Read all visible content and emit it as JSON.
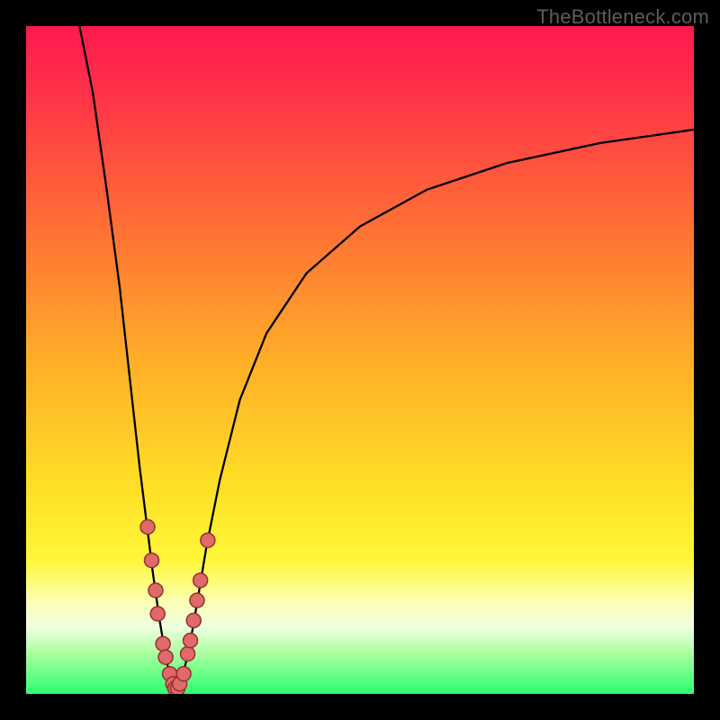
{
  "watermark": "TheBottleneck.com",
  "gradient": {
    "stops": [
      {
        "pct": 0,
        "color": "#ff1850"
      },
      {
        "pct": 12,
        "color": "#ff3846"
      },
      {
        "pct": 30,
        "color": "#ff6f35"
      },
      {
        "pct": 50,
        "color": "#ffae28"
      },
      {
        "pct": 70,
        "color": "#ffe226"
      },
      {
        "pct": 80,
        "color": "#fff73a"
      },
      {
        "pct": 86,
        "color": "#fdffb0"
      },
      {
        "pct": 90,
        "color": "#f0ffe0"
      },
      {
        "pct": 94,
        "color": "#a8ff9e"
      },
      {
        "pct": 100,
        "color": "#2cff70"
      }
    ]
  },
  "chart_data": {
    "type": "line",
    "title": "",
    "xlabel": "",
    "ylabel": "",
    "xlim": [
      0,
      100
    ],
    "ylim": [
      0,
      100
    ],
    "series": [
      {
        "name": "left-branch",
        "x": [
          8,
          10,
          12,
          14,
          15,
          16,
          17,
          18,
          19,
          20,
          20.5,
          21,
          21.5,
          22,
          22.5
        ],
        "y": [
          100,
          90,
          76,
          61,
          52,
          43,
          34,
          26,
          18,
          11,
          8,
          5,
          3,
          1.5,
          0.5
        ]
      },
      {
        "name": "right-branch",
        "x": [
          22.5,
          23,
          23.5,
          24,
          24.5,
          25,
          26,
          27,
          29,
          32,
          36,
          42,
          50,
          60,
          72,
          86,
          100
        ],
        "y": [
          0.5,
          1.5,
          3,
          5,
          7.5,
          10,
          16,
          22,
          32,
          44,
          54,
          63,
          70,
          75.5,
          79.5,
          82.5,
          84.5
        ]
      }
    ],
    "scatter": {
      "name": "highlight-dots",
      "points": [
        {
          "x": 18.2,
          "y": 25
        },
        {
          "x": 18.8,
          "y": 20
        },
        {
          "x": 19.4,
          "y": 15.5
        },
        {
          "x": 19.7,
          "y": 12
        },
        {
          "x": 20.5,
          "y": 7.5
        },
        {
          "x": 20.9,
          "y": 5.5
        },
        {
          "x": 21.5,
          "y": 3
        },
        {
          "x": 22.0,
          "y": 1.5
        },
        {
          "x": 22.3,
          "y": 0.8
        },
        {
          "x": 22.7,
          "y": 0.8
        },
        {
          "x": 23.0,
          "y": 1.5
        },
        {
          "x": 23.6,
          "y": 3
        },
        {
          "x": 24.2,
          "y": 6
        },
        {
          "x": 24.6,
          "y": 8
        },
        {
          "x": 25.1,
          "y": 11
        },
        {
          "x": 25.6,
          "y": 14
        },
        {
          "x": 26.1,
          "y": 17
        },
        {
          "x": 27.2,
          "y": 23
        }
      ],
      "radius": 8
    }
  }
}
